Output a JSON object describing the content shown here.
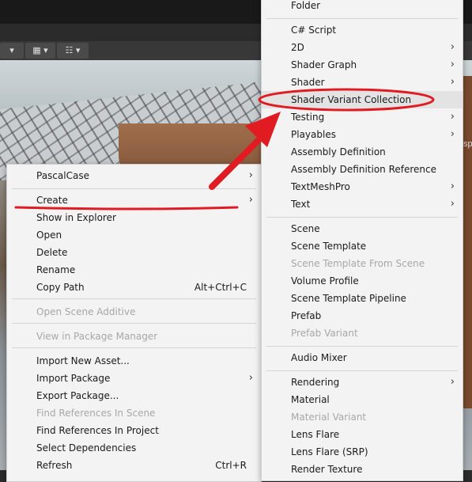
{
  "colors": {
    "annotation": "#e11b22",
    "menu_bg": "#f3f3f3",
    "highlight": "#e3e3e3"
  },
  "toolbar": {
    "icons": [
      "dropdown-arrow-icon",
      "grid-snap-icon",
      "ruler-icon"
    ]
  },
  "left_menu": {
    "items": [
      {
        "label": "PascalCase",
        "submenu": true
      },
      {
        "label": "Create",
        "submenu": true
      },
      {
        "label": "Show in Explorer"
      },
      {
        "label": "Open"
      },
      {
        "label": "Delete"
      },
      {
        "label": "Rename"
      },
      {
        "label": "Copy Path",
        "shortcut": "Alt+Ctrl+C"
      },
      {
        "label": "Open Scene Additive",
        "disabled": true
      },
      {
        "label": "View in Package Manager",
        "disabled": true
      },
      {
        "label": "Import New Asset..."
      },
      {
        "label": "Import Package",
        "submenu": true
      },
      {
        "label": "Export Package..."
      },
      {
        "label": "Find References In Scene",
        "disabled": true
      },
      {
        "label": "Find References In Project"
      },
      {
        "label": "Select Dependencies"
      },
      {
        "label": "Refresh",
        "shortcut": "Ctrl+R"
      }
    ]
  },
  "right_menu": {
    "items": [
      {
        "label": "Folder"
      },
      {
        "label": "C# Script"
      },
      {
        "label": "2D",
        "submenu": true
      },
      {
        "label": "Shader Graph",
        "submenu": true
      },
      {
        "label": "Shader",
        "submenu": true
      },
      {
        "label": "Shader Variant Collection",
        "highlighted": true
      },
      {
        "label": "Testing",
        "submenu": true
      },
      {
        "label": "Playables",
        "submenu": true
      },
      {
        "label": "Assembly Definition"
      },
      {
        "label": "Assembly Definition Reference"
      },
      {
        "label": "TextMeshPro",
        "submenu": true
      },
      {
        "label": "Text",
        "submenu": true
      },
      {
        "label": "Scene"
      },
      {
        "label": "Scene Template"
      },
      {
        "label": "Scene Template From Scene",
        "disabled": true
      },
      {
        "label": "Volume Profile"
      },
      {
        "label": "Scene Template Pipeline"
      },
      {
        "label": "Prefab"
      },
      {
        "label": "Prefab Variant",
        "disabled": true
      },
      {
        "label": "Audio Mixer"
      },
      {
        "label": "Rendering",
        "submenu": true
      },
      {
        "label": "Material"
      },
      {
        "label": "Material Variant",
        "disabled": true
      },
      {
        "label": "Lens Flare"
      },
      {
        "label": "Lens Flare (SRP)"
      },
      {
        "label": "Render Texture"
      }
    ]
  },
  "scene_overlay_text": "sp"
}
